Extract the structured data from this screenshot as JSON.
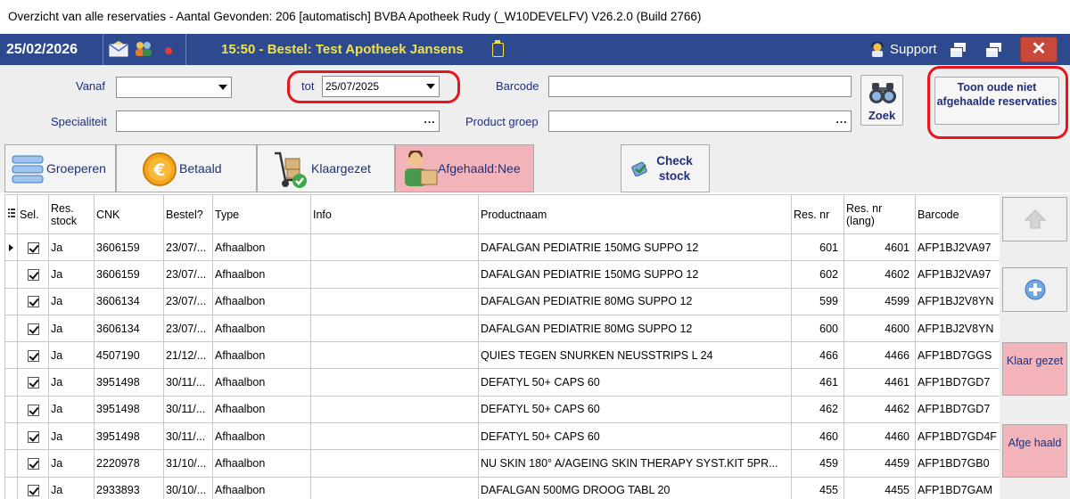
{
  "window": {
    "title": "Overzicht van alle reservaties - Aantal Gevonden: 206     [automatisch]  BVBA Apotheek Rudy (_W10DEVELFV)    V26.2.0  (Build 2766)"
  },
  "header": {
    "date": "25/02/2026",
    "message": "15:50 - Bestel: Test Apotheek Jansens",
    "support_label": "Support",
    "close_label": "✕"
  },
  "filters": {
    "vanaf_label": "Vanaf",
    "vanaf_value": "",
    "tot_label": "tot",
    "tot_value": "25/07/2025",
    "barcode_label": "Barcode",
    "barcode_value": "",
    "specialiteit_label": "Specialiteit",
    "specialiteit_value": "",
    "productgroep_label": "Product groep",
    "productgroep_value": "",
    "ellipsis": "...",
    "zoek_label": "Zoek",
    "toon_label": "Toon oude niet afgehaalde reservaties"
  },
  "toolbar": {
    "groeperen": "Groeperen",
    "betaald": "Betaald",
    "klaargezet": "Klaargezet",
    "afgehaald": "Afgehaald:Nee",
    "check_stock": "Check stock"
  },
  "table": {
    "columns": [
      "Sel.",
      "Res. stock",
      "CNK",
      "Bestel?",
      "Type",
      "Info",
      "Productnaam",
      "Res. nr",
      "Res. nr (lang)",
      "Barcode"
    ],
    "rows": [
      {
        "sel": true,
        "res_stock": "Ja",
        "cnk": "3606159",
        "bestel": "23/07/...",
        "type": "Afhaalbon",
        "info": "",
        "product": "DAFALGAN PEDIATRIE 150MG SUPPO  12",
        "res_nr": "601",
        "res_nr_lang": "4601",
        "barcode": "AFP1BJ2VA97"
      },
      {
        "sel": true,
        "res_stock": "Ja",
        "cnk": "3606159",
        "bestel": "23/07/...",
        "type": "Afhaalbon",
        "info": "",
        "product": "DAFALGAN PEDIATRIE 150MG SUPPO  12",
        "res_nr": "602",
        "res_nr_lang": "4602",
        "barcode": "AFP1BJ2VA97"
      },
      {
        "sel": true,
        "res_stock": "Ja",
        "cnk": "3606134",
        "bestel": "23/07/...",
        "type": "Afhaalbon",
        "info": "",
        "product": "DAFALGAN PEDIATRIE  80MG SUPPO  12",
        "res_nr": "599",
        "res_nr_lang": "4599",
        "barcode": "AFP1BJ2V8YN"
      },
      {
        "sel": true,
        "res_stock": "Ja",
        "cnk": "3606134",
        "bestel": "23/07/...",
        "type": "Afhaalbon",
        "info": "",
        "product": "DAFALGAN PEDIATRIE  80MG SUPPO  12",
        "res_nr": "600",
        "res_nr_lang": "4600",
        "barcode": "AFP1BJ2V8YN"
      },
      {
        "sel": true,
        "res_stock": "Ja",
        "cnk": "4507190",
        "bestel": "21/12/...",
        "type": "Afhaalbon",
        "info": "",
        "product": "QUIES TEGEN SNURKEN NEUSSTRIPS L 24",
        "res_nr": "466",
        "res_nr_lang": "4466",
        "barcode": "AFP1BD7GGS"
      },
      {
        "sel": true,
        "res_stock": "Ja",
        "cnk": "3951498",
        "bestel": "30/11/...",
        "type": "Afhaalbon",
        "info": "",
        "product": "DEFATYL 50+  CAPS 60",
        "res_nr": "461",
        "res_nr_lang": "4461",
        "barcode": "AFP1BD7GD7"
      },
      {
        "sel": true,
        "res_stock": "Ja",
        "cnk": "3951498",
        "bestel": "30/11/...",
        "type": "Afhaalbon",
        "info": "",
        "product": "DEFATYL 50+  CAPS 60",
        "res_nr": "462",
        "res_nr_lang": "4462",
        "barcode": "AFP1BD7GD7"
      },
      {
        "sel": true,
        "res_stock": "Ja",
        "cnk": "3951498",
        "bestel": "30/11/...",
        "type": "Afhaalbon",
        "info": "",
        "product": "DEFATYL 50+  CAPS 60",
        "res_nr": "460",
        "res_nr_lang": "4460",
        "barcode": "AFP1BD7GD4F"
      },
      {
        "sel": true,
        "res_stock": "Ja",
        "cnk": "2220978",
        "bestel": "31/10/...",
        "type": "Afhaalbon",
        "info": "",
        "product": "NU SKIN 180° A/AGEING SKIN THERAPY SYST.KIT 5PR...",
        "res_nr": "459",
        "res_nr_lang": "4459",
        "barcode": "AFP1BD7GB0"
      },
      {
        "sel": true,
        "res_stock": "Ja",
        "cnk": "2933893",
        "bestel": "30/10/...",
        "type": "Afhaalbon",
        "info": "",
        "product": "DAFALGAN 500MG DROOG TABL 20",
        "res_nr": "455",
        "res_nr_lang": "4455",
        "barcode": "AFP1BD7GAM"
      }
    ]
  },
  "side_panel": {
    "klaar_gezet": "Klaar gezet",
    "afge_haald": "Afge haald"
  },
  "colors": {
    "header_blue": "#2e4a8f",
    "header_text_yellow": "#f2e24a",
    "highlight_red": "#e8141e",
    "pink_button": "#f3b4b9",
    "label_blue": "#1f2f7a"
  }
}
